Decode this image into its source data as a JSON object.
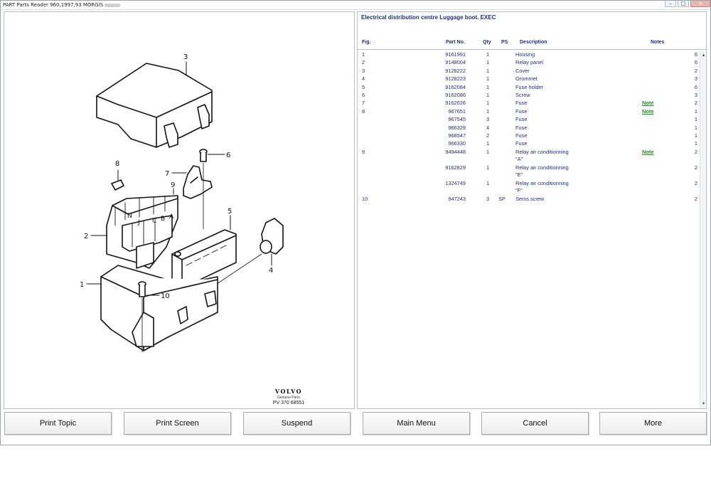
{
  "window": {
    "title": "PART Parts Reader 960,1997,93 MORGIS",
    "controls": {
      "minimize": "–",
      "maximize": "□",
      "close": "✕"
    }
  },
  "diagram": {
    "callouts": [
      "1",
      "2",
      "3",
      "4",
      "5",
      "6",
      "7",
      "8",
      "9",
      "10"
    ],
    "relay_letters": [
      "N",
      "J",
      "C",
      "B",
      "A"
    ],
    "brand_logo": "VOLVO",
    "brand_sub": "Genuine Parts",
    "brand_code": "PV 370 68551"
  },
  "parts": {
    "title": "Electrical distribution centre Luggage boot. EXEC",
    "headers": {
      "fig": "Fig.",
      "part": "Part No.",
      "qty": "Qty",
      "ps": "PS",
      "desc": "Description",
      "notes": "Notes"
    },
    "rows": [
      {
        "fig": "1",
        "part": "9161991",
        "qty": "1",
        "ps": "",
        "desc": "Housing",
        "note": "",
        "n": "6"
      },
      {
        "fig": "2",
        "part": "9148004",
        "qty": "1",
        "ps": "",
        "desc": "Relay panel",
        "note": "",
        "n": "6"
      },
      {
        "fig": "3",
        "part": "9128222",
        "qty": "1",
        "ps": "",
        "desc": "Cover",
        "note": "",
        "n": "2"
      },
      {
        "fig": "4",
        "part": "9128223",
        "qty": "1",
        "ps": "",
        "desc": "Grommet",
        "note": "",
        "n": "3"
      },
      {
        "fig": "5",
        "part": "9162084",
        "qty": "1",
        "ps": "",
        "desc": "Fuse holder",
        "note": "",
        "n": "6"
      },
      {
        "fig": "6",
        "part": "9162086",
        "qty": "1",
        "ps": "",
        "desc": "Screw",
        "note": "",
        "n": "3"
      },
      {
        "fig": "7",
        "part": "9162026",
        "qty": "1",
        "ps": "",
        "desc": "Fuse",
        "note": "Note",
        "n": "2"
      },
      {
        "fig": "8",
        "part": "967651",
        "qty": "1",
        "ps": "",
        "desc": "Fuse",
        "note": "Note",
        "n": "1"
      },
      {
        "fig": "",
        "part": "967545",
        "qty": "3",
        "ps": "",
        "desc": "Fuse",
        "note": "",
        "n": "1"
      },
      {
        "fig": "",
        "part": "966329",
        "qty": "4",
        "ps": "",
        "desc": "Fuse",
        "note": "",
        "n": "1"
      },
      {
        "fig": "",
        "part": "968547",
        "qty": "2",
        "ps": "",
        "desc": "Fuse",
        "note": "",
        "n": "1"
      },
      {
        "fig": "",
        "part": "966330",
        "qty": "1",
        "ps": "",
        "desc": "Fuse",
        "note": "",
        "n": "1"
      },
      {
        "fig": "9",
        "part": "9494448",
        "qty": "1",
        "ps": "",
        "desc": "Relay air conditionning",
        "desc2": "\"A\"",
        "note": "Note",
        "n": "2"
      },
      {
        "fig": "",
        "part": "9162829",
        "qty": "1",
        "ps": "",
        "desc": "Relay air conditionning",
        "desc2": "\"E\"",
        "note": "",
        "n": "2"
      },
      {
        "fig": "",
        "part": "1324749",
        "qty": "1",
        "ps": "",
        "desc": "Relay air conditionning",
        "desc2": "\"F\"",
        "note": "",
        "n": "2"
      },
      {
        "fig": "10",
        "part": "947243",
        "qty": "3",
        "ps": "SP",
        "desc": "Sems screw",
        "note": "",
        "n": "2"
      }
    ]
  },
  "scrollbar": {
    "up": "▲",
    "down": "▼"
  },
  "buttons": {
    "print_topic": "Print Topic",
    "print_screen": "Print Screen",
    "suspend": "Suspend",
    "main_menu": "Main Menu",
    "cancel": "Cancel",
    "more": "More"
  }
}
